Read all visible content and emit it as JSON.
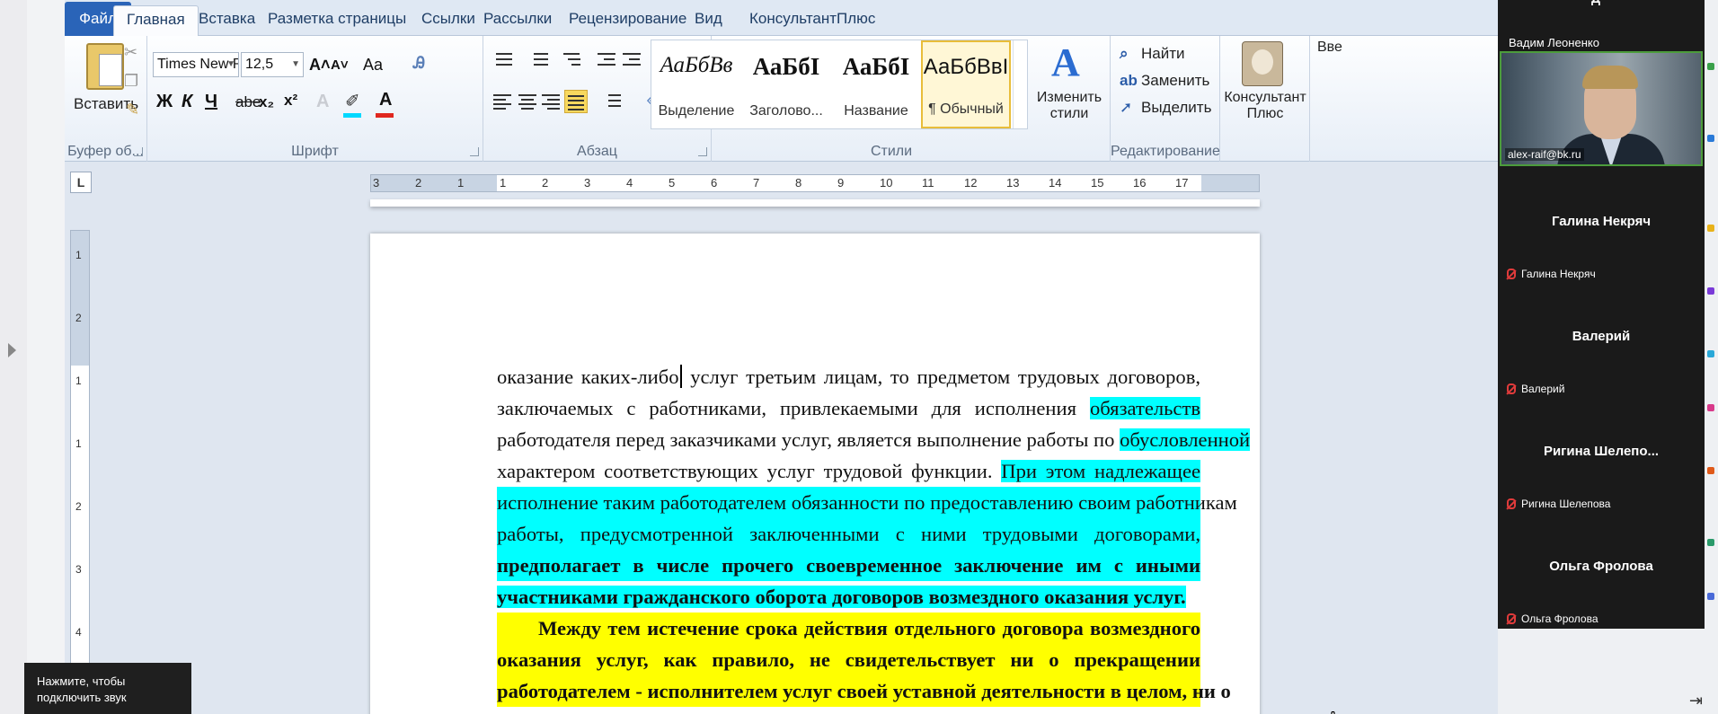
{
  "word": {
    "tabs": [
      {
        "label": "Файл"
      },
      {
        "label": "Главная"
      },
      {
        "label": "Вставка"
      },
      {
        "label": "Разметка страницы"
      },
      {
        "label": "Ссылки"
      },
      {
        "label": "Рассылки"
      },
      {
        "label": "Рецензирование"
      },
      {
        "label": "Вид"
      },
      {
        "label": "КонсультантПлюс"
      }
    ],
    "ribbon": {
      "clipboard": {
        "paste_label": "Вставить",
        "group_label": "Буфер об..."
      },
      "font": {
        "font_name": "Times New Rc",
        "font_size": "12,5",
        "group_label": "Шрифт",
        "bold": "Ж",
        "italic": "К",
        "underline": "Ч",
        "strike": "abe",
        "sub": "x₂",
        "sup": "x²",
        "grow": "A˄",
        "shrink": "A˅",
        "case": "Aa",
        "color_letter": "A"
      },
      "paragraph": {
        "group_label": "Абзац",
        "pilcrow": "¶"
      },
      "styles": {
        "group_label": "Стили",
        "items": [
          {
            "preview": "АаБбВв",
            "name": "Выделение"
          },
          {
            "preview": "АаБбI",
            "name": "Заголово..."
          },
          {
            "preview": "АаБбI",
            "name": "Название"
          },
          {
            "preview": "АаБбВвI",
            "name": "¶ Обычный"
          }
        ],
        "change_styles_label_1": "Изменить",
        "change_styles_label_2": "стили"
      },
      "editing": {
        "group_label": "Редактирование",
        "find": "Найти",
        "replace": "Заменить",
        "select": "Выделить"
      },
      "konsultant": {
        "label_1": "Консультант",
        "label_2": "Плюс"
      },
      "cut_off": "Вве"
    },
    "ruler": {
      "corner": "L",
      "h_numbers": [
        "3",
        "2",
        "1",
        "1",
        "2",
        "3",
        "4",
        "5",
        "6",
        "7",
        "8",
        "9",
        "10",
        "11",
        "12",
        "13",
        "14",
        "15",
        "16",
        "17"
      ],
      "v_numbers": [
        "1",
        "2",
        "1",
        "1",
        "2",
        "3",
        "4"
      ]
    },
    "document": {
      "p1_lines": [
        [
          "оказание каких-либо",
          "CARET",
          " услуг третьим лицам, то предметом трудовых договоров,"
        ],
        [
          "заключаемых с работниками, привлекаемыми для исполнения "
        ],
        [
          "работодателя перед заказчиками услуг, является выполнение работы по "
        ],
        [
          "характером соответствующих услуг трудовой функции. "
        ]
      ],
      "p1_hl": {
        "l2": "обязательств",
        "l3": "обусловленной",
        "l4": "При этом надлежащее",
        "l5": "исполнение таким работодателем обязанности по предоставлению своим работникам",
        "l6": "работы, предусмотренной заключенными с ними трудовыми договорами,",
        "l7": "предполагает в числе прочего своевременное заключение им с иными",
        "l8": "участниками гражданского оборота договоров возмездного оказания услуг."
      },
      "p2_lines": [
        "Между тем истечение срока действия отдельного договора возмездного",
        "оказания услуг, как правило, не свидетельствует ни о прекращении",
        "работодателем - исполнителем услуг своей уставной деятельности в целом, ни о"
      ]
    },
    "audio_tip": "Нажмите, чтобы подключить звук"
  },
  "meeting": {
    "cut_name": "Д",
    "host": {
      "title": "Вадим Леоненко",
      "email": "alex-raif@bk.ru"
    },
    "participants": [
      {
        "big": "Галина Некряч",
        "small": "Галина Некряч"
      },
      {
        "big": "Валерий",
        "small": "Валерий"
      },
      {
        "big": "Ригина Шелепо...",
        "small": "Ригина Шелепова"
      },
      {
        "big": "Ольга Фролова",
        "small": "Ольга Фролова"
      }
    ]
  },
  "colors": {
    "ribbon_accent": "#2a64b8",
    "cyan_highlight": "#00ffff",
    "yellow_highlight": "#ffff00",
    "style_selected": "#e8bd3a",
    "font_color_red": "#e0271f",
    "video_border": "#4c9c3c"
  }
}
